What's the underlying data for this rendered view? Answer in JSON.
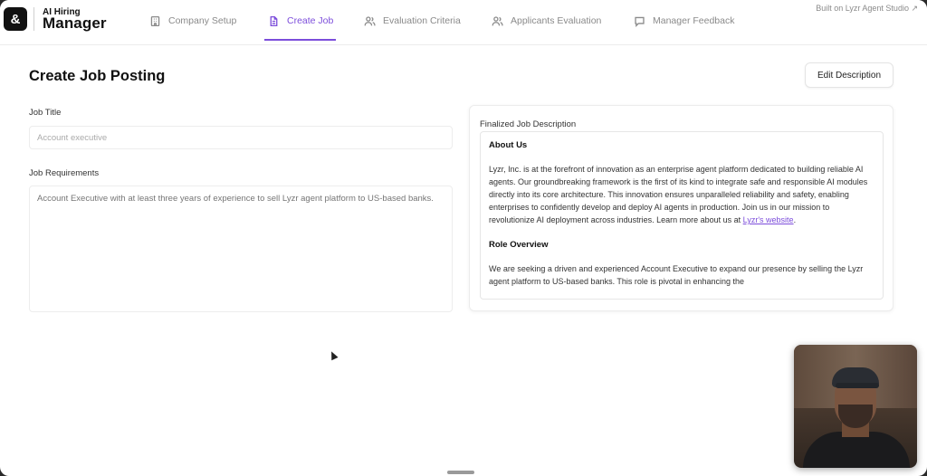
{
  "brand": {
    "logo_glyph": "&",
    "line1": "AI Hiring",
    "line2": "Manager"
  },
  "nav": {
    "items": [
      {
        "label": "Company Setup",
        "icon": "building-icon"
      },
      {
        "label": "Create Job",
        "icon": "document-icon",
        "active": true
      },
      {
        "label": "Evaluation Criteria",
        "icon": "users-icon"
      },
      {
        "label": "Applicants Evaluation",
        "icon": "users-icon"
      },
      {
        "label": "Manager Feedback",
        "icon": "chat-icon"
      }
    ],
    "built_on": "Built on Lyzr Agent Studio ↗"
  },
  "colors": {
    "accent": "#7c4ddb",
    "muted_text": "#8a8a8a"
  },
  "page": {
    "title": "Create Job Posting",
    "edit_button": "Edit Description"
  },
  "form": {
    "job_title_label": "Job Title",
    "job_title_placeholder": "Account executive",
    "requirements_label": "Job Requirements",
    "requirements_placeholder": "Account Executive with at least three years of experience to sell Lyzr agent platform to US-based banks."
  },
  "description": {
    "label": "Finalized Job Description",
    "about_heading": "About Us",
    "about_text": "Lyzr, Inc. is at the forefront of innovation as an enterprise agent platform dedicated to building reliable AI agents. Our groundbreaking framework is the first of its kind to integrate safe and responsible AI modules directly into its core architecture. This innovation ensures unparalleled reliability and safety, enabling enterprises to confidently develop and deploy AI agents in production. Join us in our mission to revolutionize AI deployment across industries. Learn more about us at ",
    "about_link": "Lyzr's website",
    "about_end": ".",
    "role_heading": "Role Overview",
    "role_text": "We are seeking a driven and experienced Account Executive to expand our presence by selling the Lyzr agent platform to US-based banks. This role is pivotal in enhancing the"
  }
}
